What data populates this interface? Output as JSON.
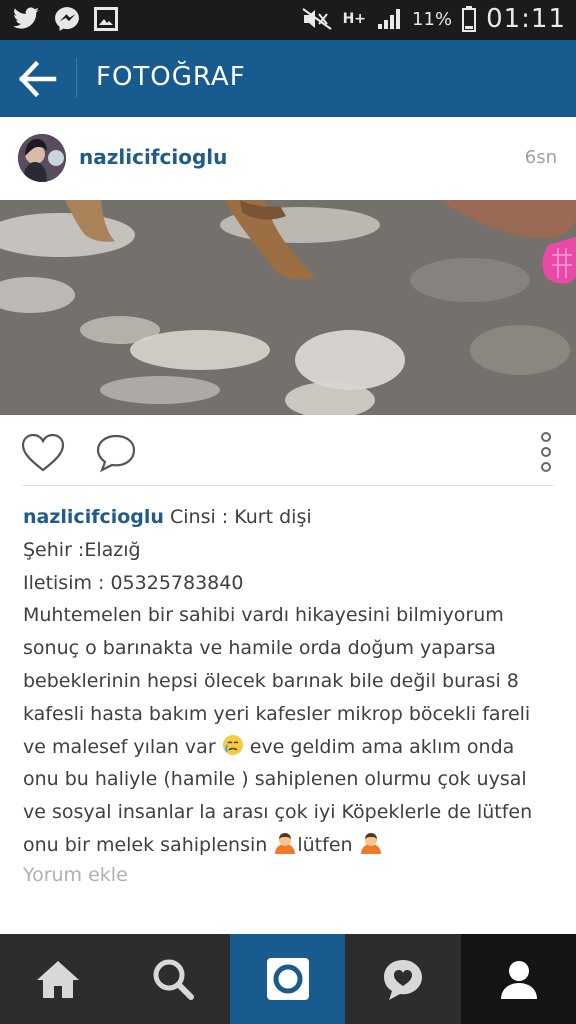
{
  "status_bar": {
    "network": "H+",
    "battery_percent": "11%",
    "time": "01:11",
    "icons": [
      "twitter-icon",
      "messenger-icon",
      "gallery-icon",
      "mute-icon",
      "signal-icon",
      "battery-icon"
    ]
  },
  "app_bar": {
    "title": "FOTOĞRAF"
  },
  "post": {
    "username": "nazlicifcioglu",
    "time_ago": "6sn",
    "caption": {
      "username": "nazlicifcioglu",
      "lines": [
        "Cinsi : Kurt dişi",
        "Şehir :Elazığ",
        "Iletisim : 05325783840",
        "Muhtemelen bir sahibi vardı hikayesini bilmiyorum",
        "sonuç o barınakta ve hamile orda doğum yaparsa",
        "bebeklerinin hepsi ölecek barınak bile değil burasi 8",
        "kafesli hasta bakım yeri kafesler mikrop böcekli fareli",
        "ve malesef yılan var",
        "eve geldim ama aklım onda",
        "onu bu haliyle (hamile ) sahiplenen olurmu çok uysal",
        "ve sosyal insanlar la arası çok iyi Köpeklerle de lütfen",
        "onu bir melek sahiplensin",
        "lütfen"
      ]
    },
    "add_comment": "Yorum ekle"
  },
  "colors": {
    "brand_blue": "#185b8f",
    "username_blue": "#1f5c8c",
    "status_bar": "#1b1b1b",
    "nav_bar": "#2d2d2d"
  },
  "bottom_nav": [
    "home-icon",
    "search-icon",
    "camera-icon",
    "activity-icon",
    "profile-icon"
  ]
}
